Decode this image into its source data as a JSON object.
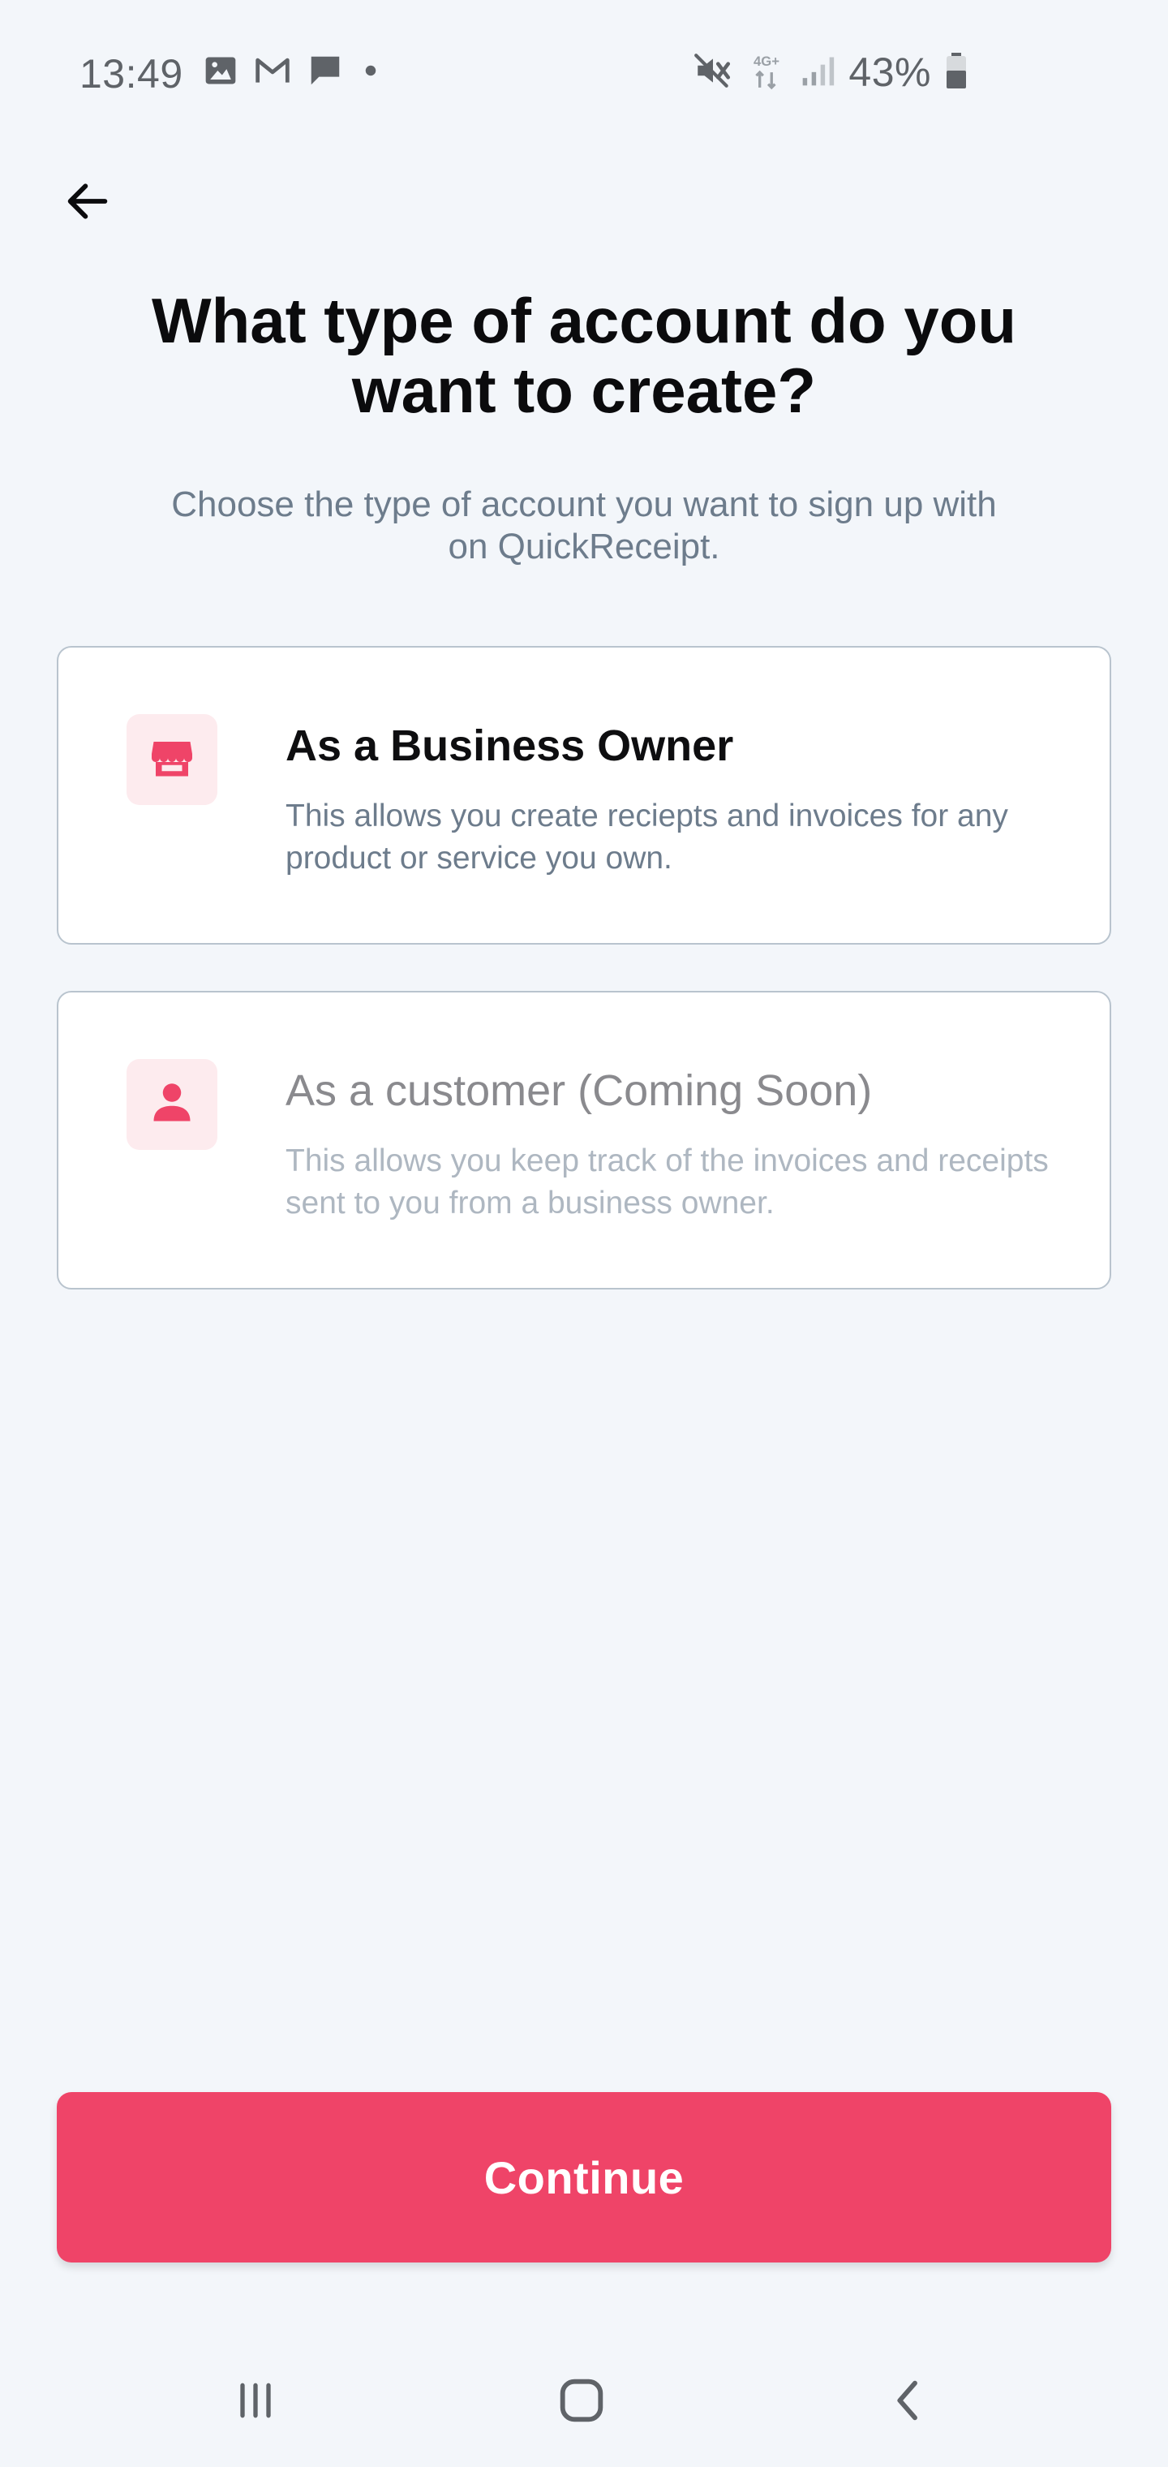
{
  "status_bar": {
    "time": "13:49",
    "network": "4G+",
    "battery": "43%",
    "icons": [
      "gallery-icon",
      "gmail-icon",
      "message-icon",
      "dot-icon",
      "mute-icon",
      "network-4g-icon",
      "signal-icon",
      "battery-icon"
    ]
  },
  "header": {
    "back_icon": "arrow-left-icon"
  },
  "main": {
    "title": "What type of account do you want to create?",
    "subtitle": "Choose the type of account you want to sign up with on QuickReceipt.",
    "options": [
      {
        "title": "As a Business Owner",
        "description": "This allows you create reciepts and invoices for any product or service you own.",
        "icon": "storefront-icon",
        "enabled": true
      },
      {
        "title": "As a customer (Coming Soon)",
        "description": "This allows you keep track of the invoices and receipts sent to you from a business owner.",
        "icon": "person-icon",
        "enabled": false
      }
    ]
  },
  "footer": {
    "continue_label": "Continue"
  },
  "nav_bar": {
    "icons": [
      "recents-icon",
      "home-icon",
      "back-icon"
    ]
  },
  "colors": {
    "accent": "#EF4468",
    "accent_light": "#FDEBEE",
    "background": "#F3F6FA",
    "text_muted": "#6D7C8C",
    "card_border": "#B9C4CE"
  }
}
